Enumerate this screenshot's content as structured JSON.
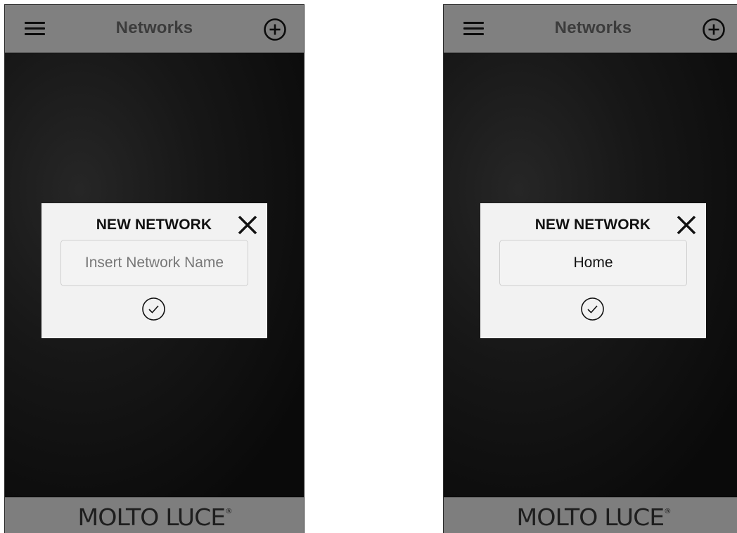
{
  "screens": [
    {
      "header": {
        "title": "Networks",
        "menu_icon": "hamburger-icon",
        "add_icon": "plus-circle-icon"
      },
      "dialog": {
        "title": "NEW NETWORK",
        "close_icon": "close-icon",
        "input": {
          "value": "",
          "placeholder": "Insert Network Name"
        },
        "confirm_icon": "check-circle-icon"
      },
      "footer": {
        "brand": "MOLTO LUCE",
        "registered_mark": "®"
      }
    },
    {
      "header": {
        "title": "Networks",
        "menu_icon": "hamburger-icon",
        "add_icon": "plus-circle-icon"
      },
      "dialog": {
        "title": "NEW NETWORK",
        "close_icon": "close-icon",
        "input": {
          "value": "Home",
          "placeholder": "Insert Network Name"
        },
        "confirm_icon": "check-circle-icon"
      },
      "footer": {
        "brand": "MOLTO LUCE",
        "registered_mark": "®"
      }
    }
  ],
  "colors": {
    "bar_background": "#808080",
    "screen_background": "#111111",
    "dialog_background": "#f2f2f2",
    "text_dark": "#111111"
  }
}
